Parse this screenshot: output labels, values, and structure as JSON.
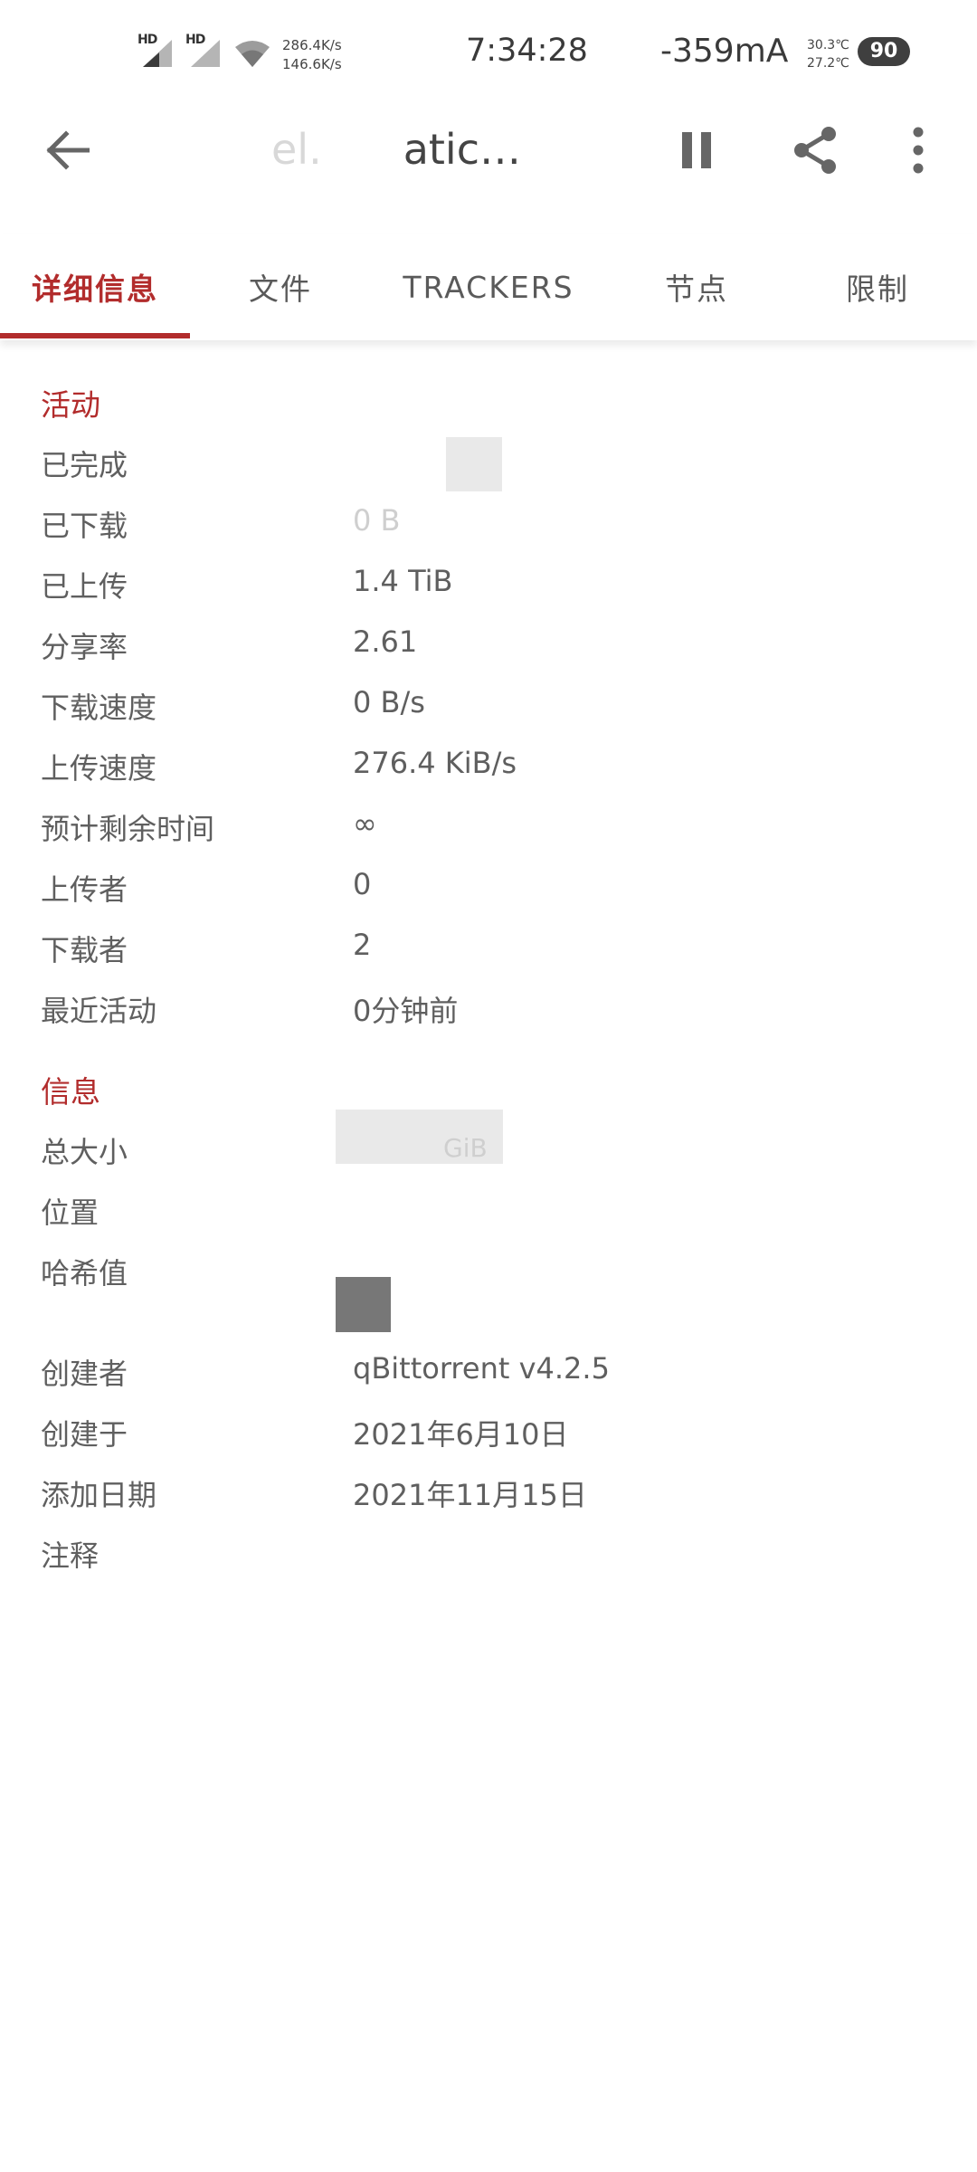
{
  "status_bar": {
    "sim1": "HD",
    "sim2": "HD",
    "speed_down": "286.4K/s",
    "speed_up": "146.6K/s",
    "time": "7:34:28",
    "current": "-359mA",
    "temp1": "30.3℃",
    "temp2": "27.2℃",
    "battery": "90"
  },
  "toolbar": {
    "title_part1": "el.",
    "title_part2": "atic…",
    "icons": [
      "back-arrow-icon",
      "pause-icon",
      "share-icon",
      "more-vert-icon"
    ]
  },
  "tabs": [
    "详细信息",
    "文件",
    "TRACKERS",
    "节点",
    "限制"
  ],
  "active_tab": 0,
  "accent_color": "#b22c2c",
  "activity": {
    "title": "活动",
    "rows": [
      {
        "label": "已完成",
        "value": ""
      },
      {
        "label": "已下载",
        "value": "0 B"
      },
      {
        "label": "已上传",
        "value": "1.4 TiB"
      },
      {
        "label": "分享率",
        "value": "2.61"
      },
      {
        "label": "下载速度",
        "value": "0 B/s"
      },
      {
        "label": "上传速度",
        "value": "276.4 KiB/s"
      },
      {
        "label": "预计剩余时间",
        "value": "∞"
      },
      {
        "label": "上传者",
        "value": "0"
      },
      {
        "label": "下载者",
        "value": "2"
      },
      {
        "label": "最近活动",
        "value": "0分钟前"
      }
    ]
  },
  "info": {
    "title": "信息",
    "rows": [
      {
        "label": "总大小",
        "value": "GiB"
      },
      {
        "label": "位置",
        "value": ""
      },
      {
        "label": "哈希值",
        "value": ""
      },
      {
        "label": "创建者",
        "value": "qBittorrent v4.2.5"
      },
      {
        "label": "创建于",
        "value": "2021年6月10日"
      },
      {
        "label": "添加日期",
        "value": "2021年11月15日"
      },
      {
        "label": "注释",
        "value": ""
      }
    ]
  }
}
